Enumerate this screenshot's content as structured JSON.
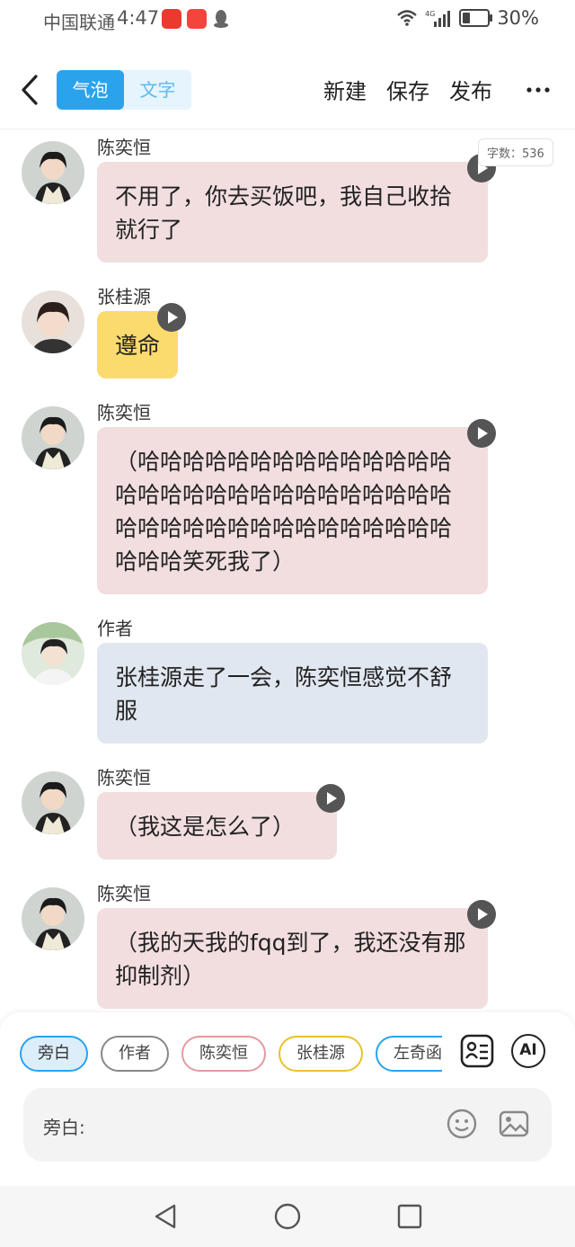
{
  "status_bar": {
    "carrier": "中国联通",
    "time": "4:47",
    "battery": "30%"
  },
  "header": {
    "tabs": [
      "气泡",
      "文字"
    ],
    "actions": [
      "新建",
      "保存",
      "发布"
    ],
    "word_count": "字数：536"
  },
  "messages": [
    {
      "name": "陈奕恒",
      "text": "不用了，你去买饭吧，我自己收拾就行了",
      "bubble_color": "#f2dedf",
      "avatar": "char1"
    },
    {
      "name": "张桂源",
      "text": "遵命",
      "bubble_color": "#fbdb6e",
      "avatar": "char2"
    },
    {
      "name": "陈奕恒",
      "text": "（哈哈哈哈哈哈哈哈哈哈哈哈哈哈哈哈哈哈哈哈哈哈哈哈哈哈哈哈哈哈哈哈哈哈哈哈哈哈哈哈哈哈哈哈哈哈哈笑死我了）",
      "bubble_color": "#f2dedf",
      "avatar": "char1"
    },
    {
      "name": "作者",
      "text": "张桂源走了一会，陈奕恒感觉不舒服",
      "bubble_color": "#e0e7f0",
      "avatar": "author"
    },
    {
      "name": "陈奕恒",
      "text": "（我这是怎么了）",
      "bubble_color": "#f2dedf",
      "avatar": "char1"
    },
    {
      "name": "陈奕恒",
      "text": "（我的天我的fqq到了，我还没有那抑制剂）",
      "bubble_color": "#f2dedf",
      "avatar": "char1"
    }
  ],
  "character_chips": [
    {
      "label": "旁白",
      "color": "#2ba3ec",
      "selected": true
    },
    {
      "label": "作者",
      "color": "#888888",
      "selected": false
    },
    {
      "label": "陈奕恒",
      "color": "#e39aa0",
      "selected": false
    },
    {
      "label": "张桂源",
      "color": "#e8c22a",
      "selected": false
    },
    {
      "label": "左奇函",
      "color": "#2ba3ec",
      "selected": false
    }
  ],
  "ai_button": "AI",
  "input": {
    "label": "旁白:"
  },
  "icons": [
    "back-icon",
    "more-icon",
    "play-icon",
    "card-icon",
    "emoji-icon",
    "image-icon",
    "nav-back-icon",
    "nav-home-icon",
    "nav-recent-icon"
  ]
}
